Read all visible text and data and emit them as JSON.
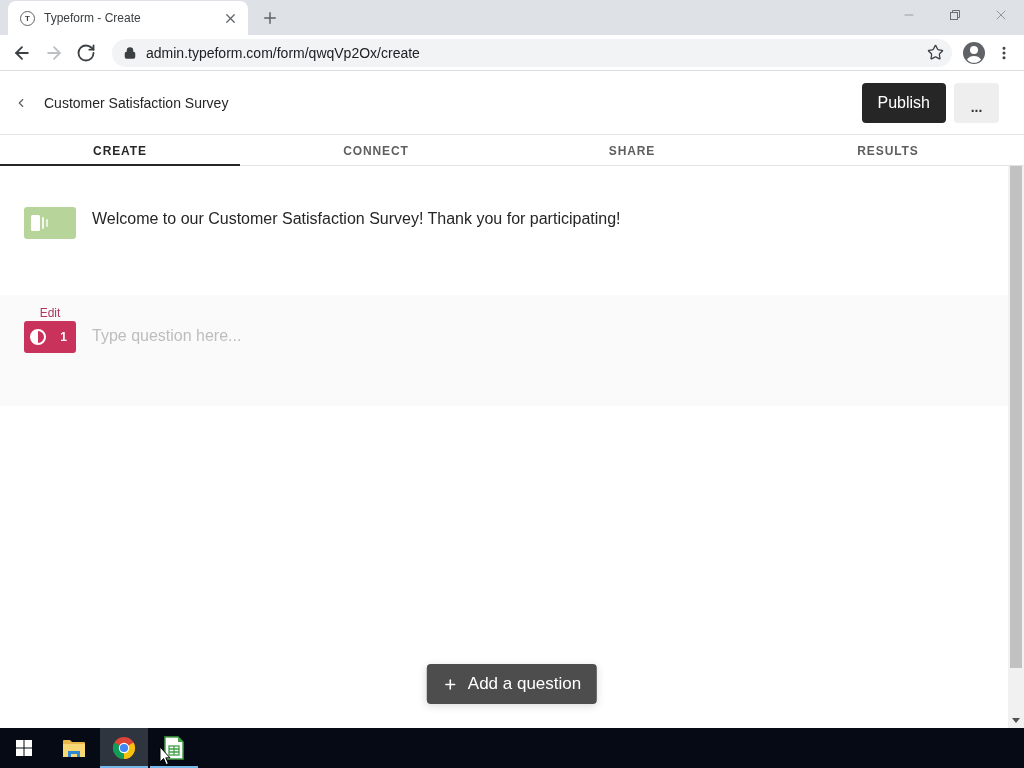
{
  "browser": {
    "tab": {
      "favicon": "T",
      "title": "Typeform - Create"
    },
    "nav": [
      {
        "kind": "back",
        "disabled": false
      },
      {
        "kind": "forward",
        "disabled": true
      },
      {
        "kind": "reload",
        "disabled": false
      }
    ],
    "address": "admin.typeform.com/form/qwqVp2Ox/create"
  },
  "header": {
    "title": "Customer Satisfaction Survey",
    "buttons": [
      {
        "kind": "primary",
        "label": "Publish"
      },
      {
        "kind": "more",
        "label": "..."
      }
    ]
  },
  "tabs": [
    {
      "label": "CREATE",
      "selected": true
    },
    {
      "label": "CONNECT",
      "selected": false
    },
    {
      "label": "SHARE",
      "selected": false
    },
    {
      "label": "RESULTS",
      "selected": false
    }
  ],
  "blocks": [
    {
      "kind": "welcome",
      "color": "#b7d59a",
      "text": "Welcome to our Customer Satisfaction Survey! Thank you for participating!"
    },
    {
      "kind": "question",
      "color": "#c9325b",
      "edit": "Edit",
      "number": "1",
      "placeholder": "Type question here..."
    }
  ],
  "add_button": {
    "label": "Add a question"
  },
  "taskbar": [
    {
      "kind": "start",
      "open": false,
      "active": false
    },
    {
      "kind": "folder",
      "open": false,
      "active": false
    },
    {
      "kind": "browser",
      "open": true,
      "active": true
    },
    {
      "kind": "spreadsheet",
      "open": true,
      "active": false
    }
  ]
}
